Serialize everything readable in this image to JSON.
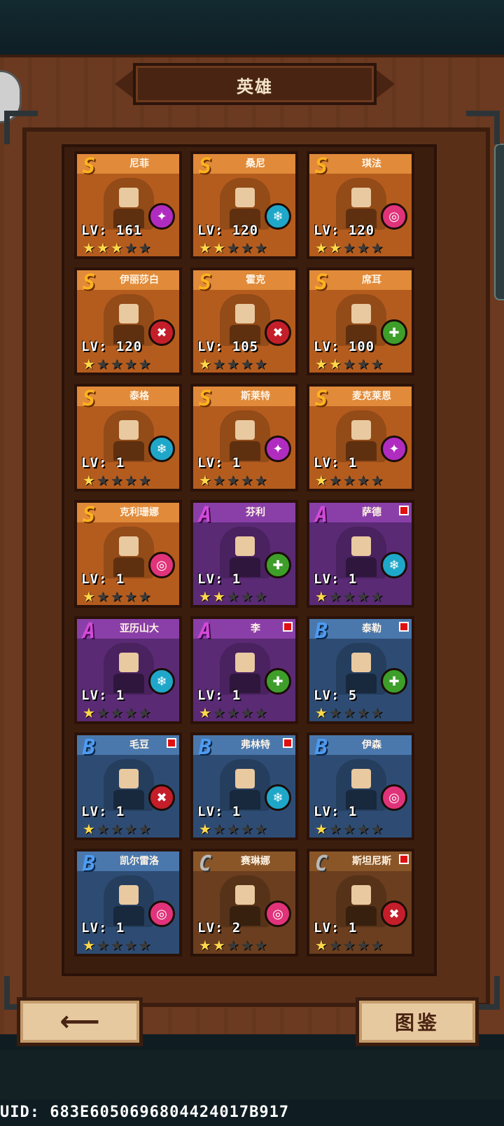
{
  "header": {
    "title": "英雄"
  },
  "heroes": [
    {
      "name": "尼菲",
      "rank": "S",
      "level": "LV: 161",
      "stars": 3,
      "cls": "magic",
      "new": false
    },
    {
      "name": "桑尼",
      "rank": "S",
      "level": "LV: 120",
      "stars": 2,
      "cls": "ice",
      "new": false
    },
    {
      "name": "琪法",
      "rank": "S",
      "level": "LV: 120",
      "stars": 2,
      "cls": "spirit",
      "new": false
    },
    {
      "name": "伊丽莎白",
      "rank": "S",
      "level": "LV: 120",
      "stars": 1,
      "cls": "fire",
      "new": false
    },
    {
      "name": "霍克",
      "rank": "S",
      "level": "LV: 105",
      "stars": 1,
      "cls": "fire",
      "new": false
    },
    {
      "name": "席耳",
      "rank": "S",
      "level": "LV: 100",
      "stars": 2,
      "cls": "nature",
      "new": false
    },
    {
      "name": "泰格",
      "rank": "S",
      "level": "LV: 1",
      "stars": 1,
      "cls": "ice",
      "new": false
    },
    {
      "name": "斯莱特",
      "rank": "S",
      "level": "LV: 1",
      "stars": 1,
      "cls": "magic",
      "new": false
    },
    {
      "name": "麦克莱恩",
      "rank": "S",
      "level": "LV: 1",
      "stars": 1,
      "cls": "magic",
      "new": false
    },
    {
      "name": "克利珊娜",
      "rank": "S",
      "level": "LV: 1",
      "stars": 1,
      "cls": "spirit",
      "new": false
    },
    {
      "name": "芬利",
      "rank": "A",
      "level": "LV: 1",
      "stars": 2,
      "cls": "nature",
      "new": false
    },
    {
      "name": "萨德",
      "rank": "A",
      "level": "LV: 1",
      "stars": 1,
      "cls": "ice",
      "new": true
    },
    {
      "name": "亚历山大",
      "rank": "A",
      "level": "LV: 1",
      "stars": 1,
      "cls": "ice",
      "new": false
    },
    {
      "name": "李",
      "rank": "A",
      "level": "LV: 1",
      "stars": 1,
      "cls": "nature",
      "new": true
    },
    {
      "name": "泰勒",
      "rank": "B",
      "level": "LV: 5",
      "stars": 1,
      "cls": "nature",
      "new": true
    },
    {
      "name": "毛豆",
      "rank": "B",
      "level": "LV: 1",
      "stars": 1,
      "cls": "fire",
      "new": true
    },
    {
      "name": "弗林特",
      "rank": "B",
      "level": "LV: 1",
      "stars": 1,
      "cls": "ice",
      "new": true
    },
    {
      "name": "伊森",
      "rank": "B",
      "level": "LV: 1",
      "stars": 1,
      "cls": "spirit",
      "new": false
    },
    {
      "name": "凯尔雷洛",
      "rank": "B",
      "level": "LV: 1",
      "stars": 1,
      "cls": "spirit",
      "new": false
    },
    {
      "name": "赛琳娜",
      "rank": "C",
      "level": "LV: 2",
      "stars": 2,
      "cls": "spirit",
      "new": false
    },
    {
      "name": "斯坦尼斯",
      "rank": "C",
      "level": "LV: 1",
      "stars": 1,
      "cls": "fire",
      "new": true
    }
  ],
  "buttons": {
    "back_icon": "arrow-left-icon",
    "dex_label": "图鉴"
  },
  "uid": "UID: 683E6050696804424017B917"
}
